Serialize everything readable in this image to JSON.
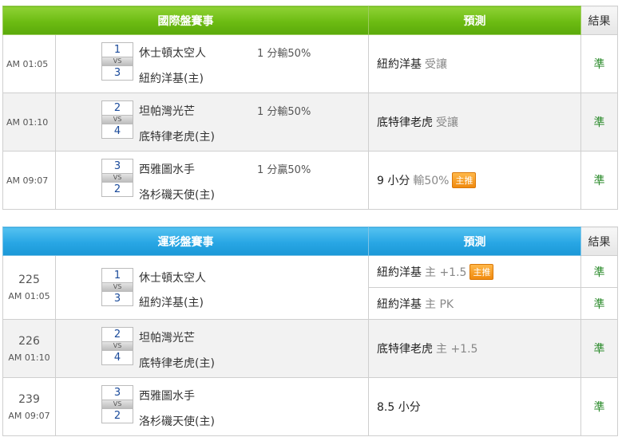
{
  "international": {
    "headers": {
      "event": "國際盤賽事",
      "prediction": "預測",
      "result": "結果"
    },
    "rows": [
      {
        "time": "AM 01:05",
        "home_num": "1",
        "away_num": "3",
        "vs": "VS",
        "team_top": "休士頓太空人",
        "team_bottom": "紐約洋基(主)",
        "odds": "1 分輸50%",
        "pred_main": "紐約洋基",
        "pred_sub": "受讓",
        "badge": "",
        "result": "準"
      },
      {
        "time": "AM 01:10",
        "home_num": "2",
        "away_num": "4",
        "vs": "VS",
        "team_top": "坦帕灣光芒",
        "team_bottom": "底特律老虎(主)",
        "odds": "1 分輸50%",
        "pred_main": "底特律老虎",
        "pred_sub": "受讓",
        "badge": "",
        "result": "準"
      },
      {
        "time": "AM 09:07",
        "home_num": "3",
        "away_num": "2",
        "vs": "VS",
        "team_top": "西雅圖水手",
        "team_bottom": "洛杉磯天使(主)",
        "odds": "1 分贏50%",
        "pred_main": "9 小分",
        "pred_sub": "輸50%",
        "badge": "主推",
        "result": "準"
      }
    ]
  },
  "sports_lottery": {
    "headers": {
      "event": "運彩盤賽事",
      "prediction": "預測",
      "result": "結果"
    },
    "rows": [
      {
        "code": "225",
        "time": "AM 01:05",
        "home_num": "1",
        "away_num": "3",
        "vs": "VS",
        "team_top": "休士頓太空人",
        "team_bottom": "紐約洋基(主)",
        "preds": [
          {
            "main": "紐約洋基",
            "sub": "主 +1.5",
            "badge": "主推",
            "result": "準"
          },
          {
            "main": "紐約洋基",
            "sub": "主 PK",
            "badge": "",
            "result": "準"
          }
        ]
      },
      {
        "code": "226",
        "time": "AM 01:10",
        "home_num": "2",
        "away_num": "4",
        "vs": "VS",
        "team_top": "坦帕灣光芒",
        "team_bottom": "底特律老虎(主)",
        "preds": [
          {
            "main": "底特律老虎",
            "sub": "主 +1.5",
            "badge": "",
            "result": "準"
          }
        ]
      },
      {
        "code": "239",
        "time": "AM 09:07",
        "home_num": "3",
        "away_num": "2",
        "vs": "VS",
        "team_top": "西雅圖水手",
        "team_bottom": "洛杉磯天使(主)",
        "preds": [
          {
            "main": "8.5 小分",
            "sub": "",
            "badge": "",
            "result": "準"
          }
        ]
      }
    ]
  },
  "colors": {
    "green_header": "#6cbb12",
    "blue_header": "#28a6e4",
    "result_green": "#2a8a2a",
    "badge_orange": "#f08a0e"
  }
}
